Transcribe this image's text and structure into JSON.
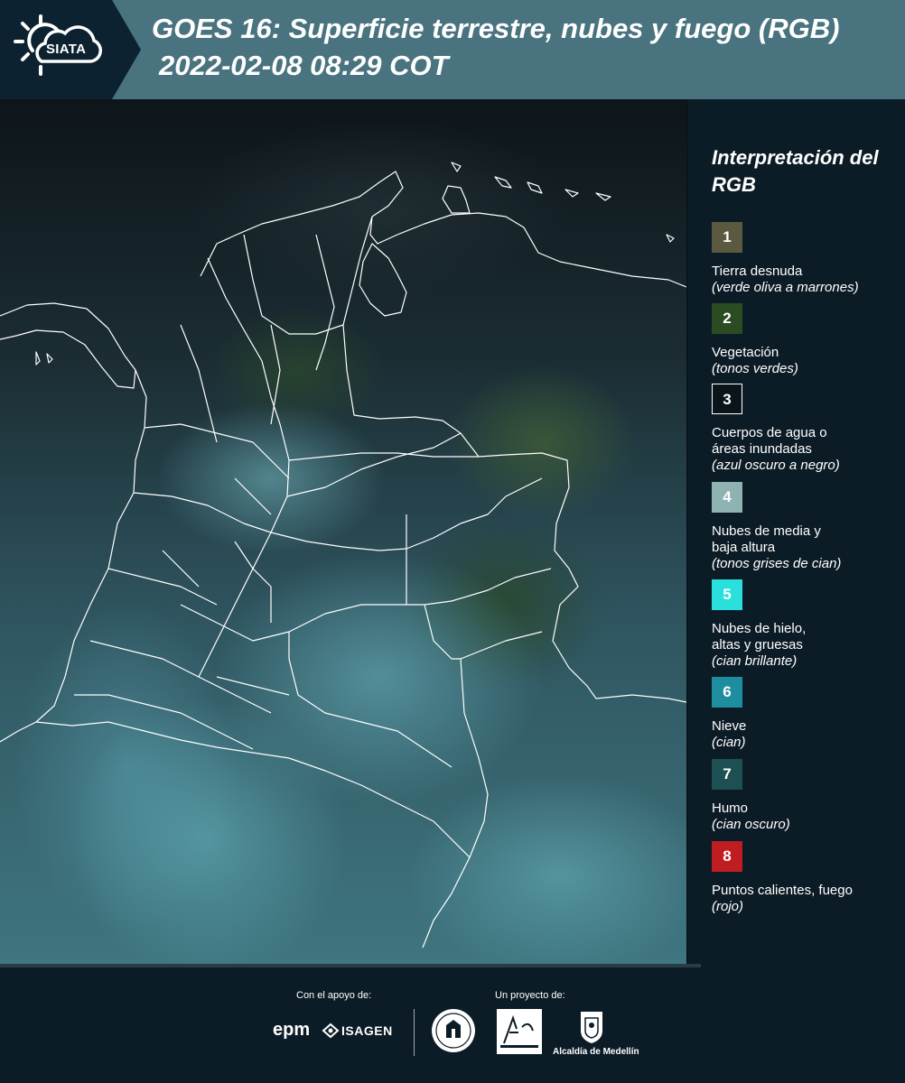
{
  "header": {
    "logo_text": "SIATA",
    "title_line1": "GOES 16: Superficie terrestre, nubes y fuego (RGB)",
    "title_line2": "2022-02-08 08:29 COT",
    "background_color": "#48737f",
    "logo_panel_color": "#0d2230"
  },
  "legend": {
    "title": "Interpretación del RGB",
    "items": [
      {
        "number": "1",
        "label": "Tierra desnuda",
        "note": "(verde oliva a marrones)",
        "color": "#5b5a41"
      },
      {
        "number": "2",
        "label": "Vegetación",
        "note": "(tonos verdes)",
        "color": "#2b4b22"
      },
      {
        "number": "3",
        "label": "Cuerpos de agua o áreas inundadas",
        "note": "(azul oscuro a negro)",
        "color": "#0a141b"
      },
      {
        "number": "4",
        "label": "Nubes de media y baja altura",
        "note": "(tonos grises de cian)",
        "color": "#8fb3b2"
      },
      {
        "number": "5",
        "label": "Nubes de hielo, altas y gruesas",
        "note": "(cian brillante)",
        "color": "#29e0dc"
      },
      {
        "number": "6",
        "label": "Nieve",
        "note": "(cian)",
        "color": "#1e8da0"
      },
      {
        "number": "7",
        "label": "Humo",
        "note": "(cian oscuro)",
        "color": "#1e4f52"
      },
      {
        "number": "8",
        "label": "Puntos calientes, fuego",
        "note": "(rojo)",
        "color": "#c01d22"
      }
    ]
  },
  "footer": {
    "support_label": "Con el apoyo de:",
    "project_label": "Un proyecto de:",
    "sponsors": [
      "epm",
      "ISAGEN"
    ],
    "project_partners": [
      "Área Metropolitana Valle de Aburrá",
      "Alcaldía de Medellín"
    ],
    "alcaldia_label": "Alcaldía de Medellín"
  }
}
